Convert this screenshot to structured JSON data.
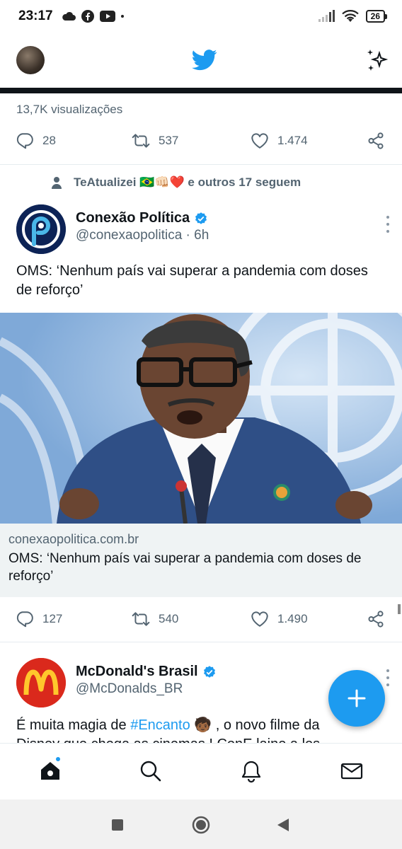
{
  "status_bar": {
    "time": "23:17",
    "battery": "26"
  },
  "previous_tweet": {
    "views": "13,7K visualizações",
    "replies": "28",
    "retweets": "537",
    "likes": "1.474"
  },
  "tweet1": {
    "social_context": "TeAtualizei 🇧🇷👊🏻❤️ e outros 17 seguem",
    "display_name": "Conexão Política",
    "handle_time": "@conexaopolitica · 6h",
    "text": "OMS: ‘Nenhum país vai superar a pandemia com doses de reforço’",
    "card_domain": "conexaopolitica.com.br",
    "card_title": "OMS: ‘Nenhum país vai superar a pandemia com doses de reforço’",
    "replies": "127",
    "retweets": "540",
    "likes": "1.490"
  },
  "tweet2": {
    "display_name": "McDonald's Brasil",
    "handle": "@McDonalds_BR",
    "text_before": "É muita magia de ",
    "hashtag": "#Encanto",
    "text_after": " 🧒🏾 , o novo filme da",
    "text_line2": "Disney que chega as cinemas ! ConE laine a los"
  },
  "colors": {
    "accent": "#1d9bf0",
    "muted": "#536471",
    "text": "#0f1419"
  },
  "icons": [
    "twitter-bird-icon",
    "sparkle-icon",
    "reply-icon",
    "retweet-icon",
    "like-icon",
    "share-icon",
    "verified-icon",
    "home-icon",
    "search-icon",
    "notifications-icon",
    "messages-icon",
    "compose-icon"
  ]
}
